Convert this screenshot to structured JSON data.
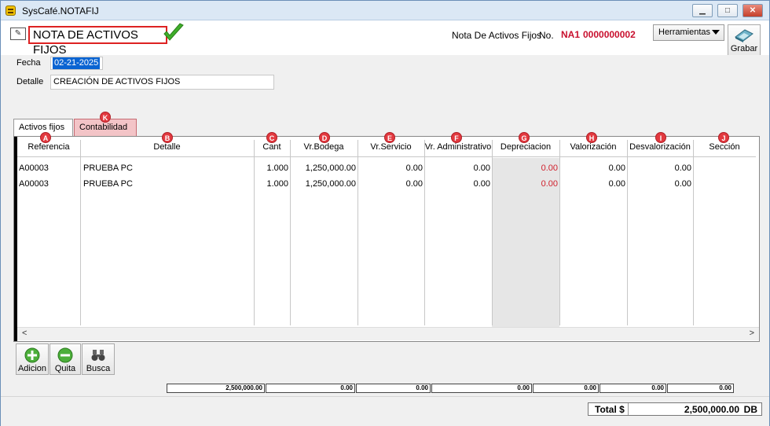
{
  "window": {
    "title": "SysCafé.NOTAFIJ",
    "minimize": "▁",
    "maximize": "□",
    "close": "✕"
  },
  "header": {
    "doc_title": "NOTA DE ACTIVOS FIJOS",
    "note_label": "Nota De Activos Fijos",
    "no_label": "No.",
    "prefix": "NA1",
    "number": "0000000002",
    "tools_label": "Herramientas",
    "save_label": "Grabar"
  },
  "form": {
    "fecha_label": "Fecha",
    "fecha_value": "02-21-2025",
    "detalle_label": "Detalle",
    "detalle_value": "CREACIÓN DE ACTIVOS FIJOS"
  },
  "tabs": [
    {
      "label": "Activos fijos",
      "active": true
    },
    {
      "label": "Contabilidad",
      "badge": "K"
    }
  ],
  "grid": {
    "columns": [
      {
        "badge": "A",
        "label": "Referencia"
      },
      {
        "badge": "B",
        "label": "Detalle"
      },
      {
        "badge": "C",
        "label": "Cant"
      },
      {
        "badge": "D",
        "label": "Vr.Bodega"
      },
      {
        "badge": "E",
        "label": "Vr.Servicio"
      },
      {
        "badge": "F",
        "label": "Vr. Administrativo"
      },
      {
        "badge": "G",
        "label": "Depreciacion"
      },
      {
        "badge": "H",
        "label": "Valorización"
      },
      {
        "badge": "I",
        "label": "Desvalorización"
      },
      {
        "badge": "J",
        "label": "Sección"
      }
    ],
    "rows": [
      [
        "A00003",
        "PRUEBA PC",
        "1.000",
        "1,250,000.00",
        "0.00",
        "0.00",
        "0.00",
        "0.00",
        "0.00",
        ""
      ],
      [
        "A00003",
        "PRUEBA PC",
        "1.000",
        "1,250,000.00",
        "0.00",
        "0.00",
        "0.00",
        "0.00",
        "0.00",
        ""
      ]
    ],
    "scroll_left": "<",
    "scroll_right": ">"
  },
  "toolbar": {
    "add_label": "Adicion",
    "remove_label": "Quita",
    "search_label": "Busca"
  },
  "totals": [
    "2,500,000.00",
    "0.00",
    "0.00",
    "0.00",
    "0.00",
    "0.00",
    "0.00"
  ],
  "status": {
    "total_label": "Total $",
    "total_value": "2,500,000.00",
    "total_unit": "DB"
  },
  "colors": {
    "accent_red": "#c8102e",
    "badge_red": "#e2393f",
    "selection_blue": "#0a64d2",
    "depreciation_red": "#d0202c"
  }
}
